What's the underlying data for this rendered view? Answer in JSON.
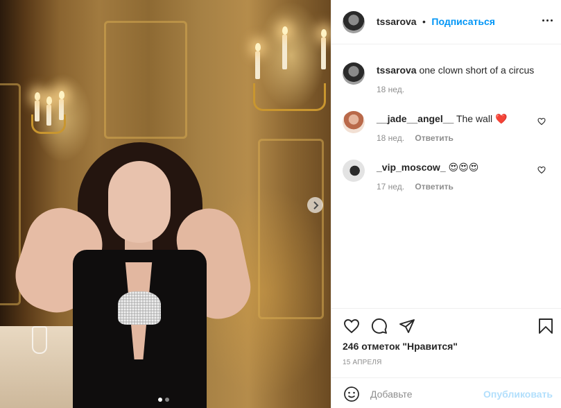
{
  "post": {
    "author": "tssarova",
    "separator": "•",
    "follow_label": "Подписаться",
    "caption": {
      "username": "tssarova",
      "text": "one clown short of a circus",
      "time": "18 нед."
    },
    "comments": [
      {
        "username": "__jade__angel__",
        "text": "The wall ❤️",
        "time": "18 нед.",
        "reply_label": "Ответить"
      },
      {
        "username": "_vip_moscow_",
        "text": "😍😍😍",
        "time": "17 нед.",
        "reply_label": "Ответить"
      }
    ],
    "likes_text": "246 отметок \"Нравится\"",
    "date": "15 АПРЕЛЯ",
    "add_comment_placeholder": "Добавьте",
    "publish_label": "Опубликовать",
    "carousel": {
      "total": 2,
      "active": 1
    }
  },
  "colors": {
    "accent_blue": "#0095f6",
    "publish_disabled": "#b2dffc",
    "text": "#262626",
    "muted": "#8e8e8e"
  },
  "icons": [
    "more-options-icon",
    "heart-icon",
    "comment-icon",
    "share-icon",
    "bookmark-icon",
    "emoji-icon",
    "chevron-right-icon"
  ]
}
